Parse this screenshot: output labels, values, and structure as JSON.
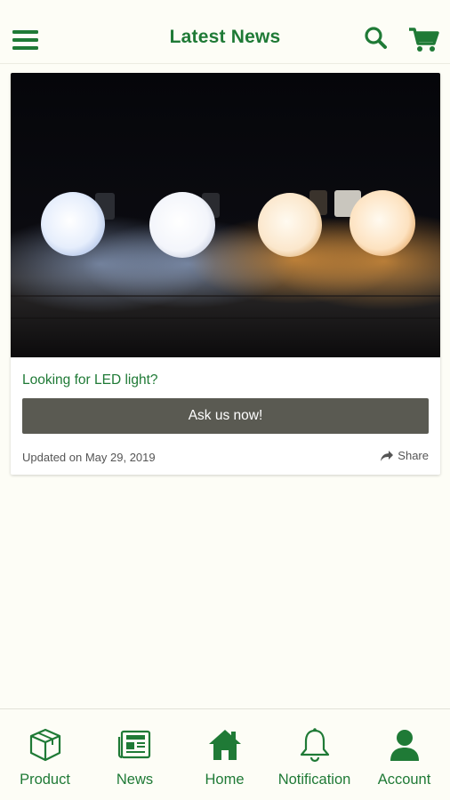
{
  "header": {
    "title": "Latest News",
    "menu_icon": "hamburger-menu-icon",
    "search_icon": "search-icon",
    "cart_icon": "shopping-cart-icon"
  },
  "news_card": {
    "image": "led-bulbs-photo",
    "headline": "Looking for LED light?",
    "cta_label": "Ask us now!",
    "updated": "Updated on May 29, 2019",
    "share_label": "Share",
    "share_icon": "share-arrow-icon"
  },
  "bottom_nav": {
    "items": [
      {
        "label": "Product",
        "icon": "box-icon"
      },
      {
        "label": "News",
        "icon": "newspaper-icon"
      },
      {
        "label": "Home",
        "icon": "home-icon"
      },
      {
        "label": "Notification",
        "icon": "bell-icon"
      },
      {
        "label": "Account",
        "icon": "user-icon"
      }
    ]
  },
  "colors": {
    "accent": "#1f7a36",
    "background": "#fdfdf6",
    "button": "#5a5a52"
  }
}
